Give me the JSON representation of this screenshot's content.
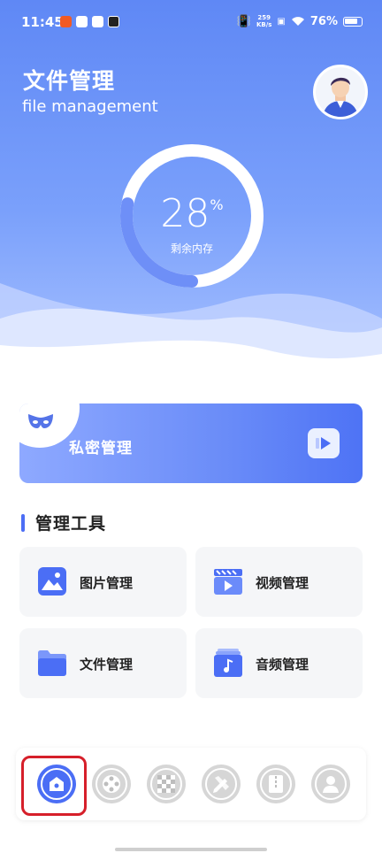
{
  "status_bar": {
    "time": "11:45",
    "net_speed_value": "259",
    "net_speed_unit": "KB/s",
    "battery": "76%"
  },
  "header": {
    "title_cn": "文件管理",
    "title_en": "file management"
  },
  "storage": {
    "percent_value": "28",
    "percent_unit": "%",
    "label": "剩余内存",
    "fraction": 0.28
  },
  "private": {
    "label": "私密管理"
  },
  "tools_section": {
    "title": "管理工具",
    "items": [
      {
        "label": "图片管理",
        "icon": "image-icon"
      },
      {
        "label": "视频管理",
        "icon": "video-icon"
      },
      {
        "label": "文件管理",
        "icon": "folder-icon"
      },
      {
        "label": "音频管理",
        "icon": "music-icon"
      }
    ]
  },
  "nav": {
    "items": [
      {
        "icon": "home-icon",
        "active": true
      },
      {
        "icon": "film-reel-icon",
        "active": false
      },
      {
        "icon": "checkerboard-icon",
        "active": false
      },
      {
        "icon": "pencil-ruler-icon",
        "active": false
      },
      {
        "icon": "zip-file-icon",
        "active": false
      },
      {
        "icon": "user-icon",
        "active": false
      }
    ]
  },
  "colors": {
    "accent": "#4b6ef5",
    "highlight": "#d61f2a"
  }
}
